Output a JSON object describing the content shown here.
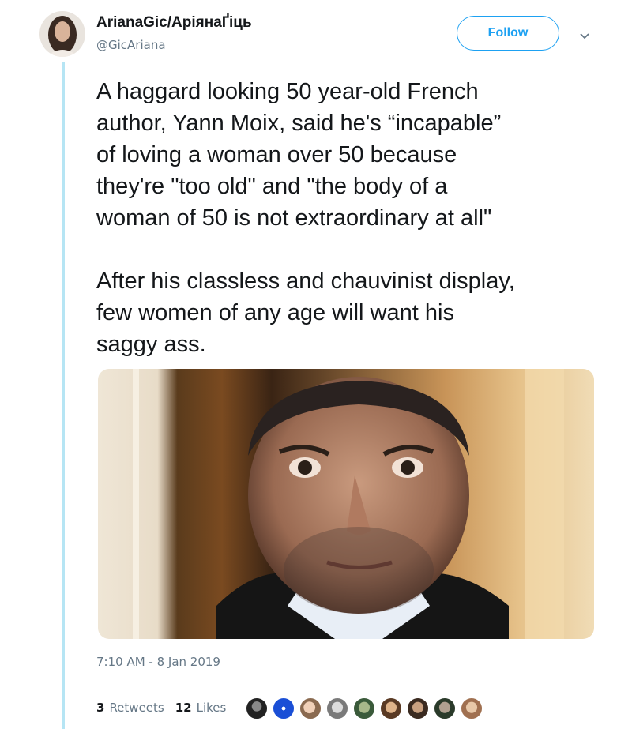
{
  "tweet": {
    "display_name": "ArianaGic/АріянаҐіць",
    "handle": "@GicAriana",
    "follow_label": "Follow",
    "paragraphs": [
      "A haggard looking 50 year-old French\nauthor, Yann Moix, said he's “incapable”\nof loving a woman over 50 because\nthey're \"too old\" and \"the body of a\nwoman of 50 is not extraordinary at all\"",
      "After his classless and chauvinist display,\nfew women of any age will want his\nsaggy ass."
    ],
    "timestamp": "7:10 AM - 8 Jan 2019",
    "stats": {
      "retweets_count": "3",
      "retweets_label": "Retweets",
      "likes_count": "12",
      "likes_label": "Likes"
    }
  },
  "colors": {
    "accent": "#1da1f2",
    "thread_line": "#b6e5f4",
    "secondary_text": "#657786",
    "primary_text": "#14171a"
  },
  "icons": [
    "chevron-down-icon"
  ]
}
